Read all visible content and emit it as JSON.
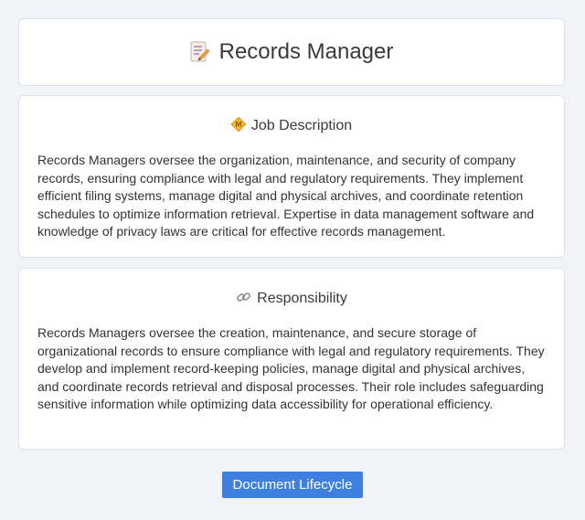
{
  "header": {
    "icon": "memo-icon",
    "title": "Records Manager"
  },
  "job_description": {
    "icon": "badge-icon",
    "title": "Job Description",
    "text": "Records Managers oversee the organization, maintenance, and security of company records, ensuring compliance with legal and regulatory requirements. They implement efficient filing systems, manage digital and physical archives, and coordinate retention schedules to optimize information retrieval. Expertise in data management software and knowledge of privacy laws are critical for effective records management."
  },
  "responsibility": {
    "icon": "link-icon",
    "title": "Responsibility",
    "text": "Records Managers oversee the creation, maintenance, and secure storage of organizational records to ensure compliance with legal and regulatory requirements. They develop and implement record-keeping policies, manage digital and physical archives, and coordinate records retrieval and disposal processes. Their role includes safeguarding sensitive information while optimizing data accessibility for operational efficiency."
  },
  "button": {
    "label": "Document Lifecycle",
    "color": "#3f7fe0"
  }
}
